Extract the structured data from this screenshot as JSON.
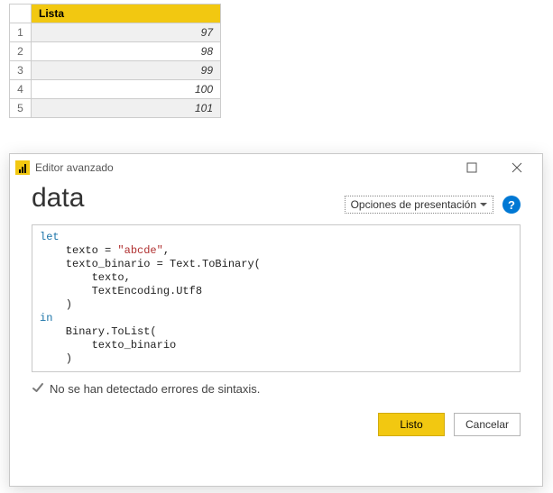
{
  "table": {
    "header": "Lista",
    "rows": [
      {
        "idx": "1",
        "value": "97"
      },
      {
        "idx": "2",
        "value": "98"
      },
      {
        "idx": "3",
        "value": "99"
      },
      {
        "idx": "4",
        "value": "100"
      },
      {
        "idx": "5",
        "value": "101"
      }
    ]
  },
  "dialog": {
    "window_title": "Editor avanzado",
    "title": "data",
    "options_label": "Opciones de presentación",
    "help_symbol": "?",
    "code": {
      "let": "let",
      "in": "in",
      "line1a": "    texto = ",
      "line1str": "\"abcde\"",
      "line1b": ",",
      "line2": "    texto_binario = Text.ToBinary(",
      "line3": "        texto,",
      "line4": "        TextEncoding.Utf8",
      "line5": "    )",
      "line7": "    Binary.ToList(",
      "line8": "        texto_binario",
      "line9": "    )"
    },
    "status_text": "No se han detectado errores de sintaxis.",
    "done_label": "Listo",
    "cancel_label": "Cancelar"
  }
}
